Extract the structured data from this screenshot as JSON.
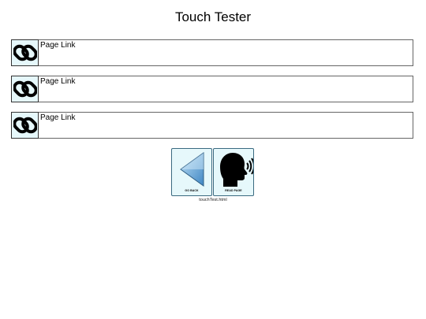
{
  "page": {
    "title": "Touch Tester"
  },
  "links": [
    {
      "label": "Page Link",
      "icon": "link-chain-icon"
    },
    {
      "label": "Page Link",
      "icon": "link-chain-icon"
    },
    {
      "label": "Page Link",
      "icon": "link-chain-icon"
    }
  ],
  "buttons": {
    "go_back": {
      "label": "GO BACK",
      "icon": "back-arrow-icon"
    },
    "read_page": {
      "label": "READ PAGE",
      "icon": "speaking-head-icon"
    }
  },
  "footer": {
    "filename": "touchTest.html"
  },
  "colors": {
    "button_bg": "#e6f8fb",
    "arrow_blue": "#5a9fd4"
  }
}
